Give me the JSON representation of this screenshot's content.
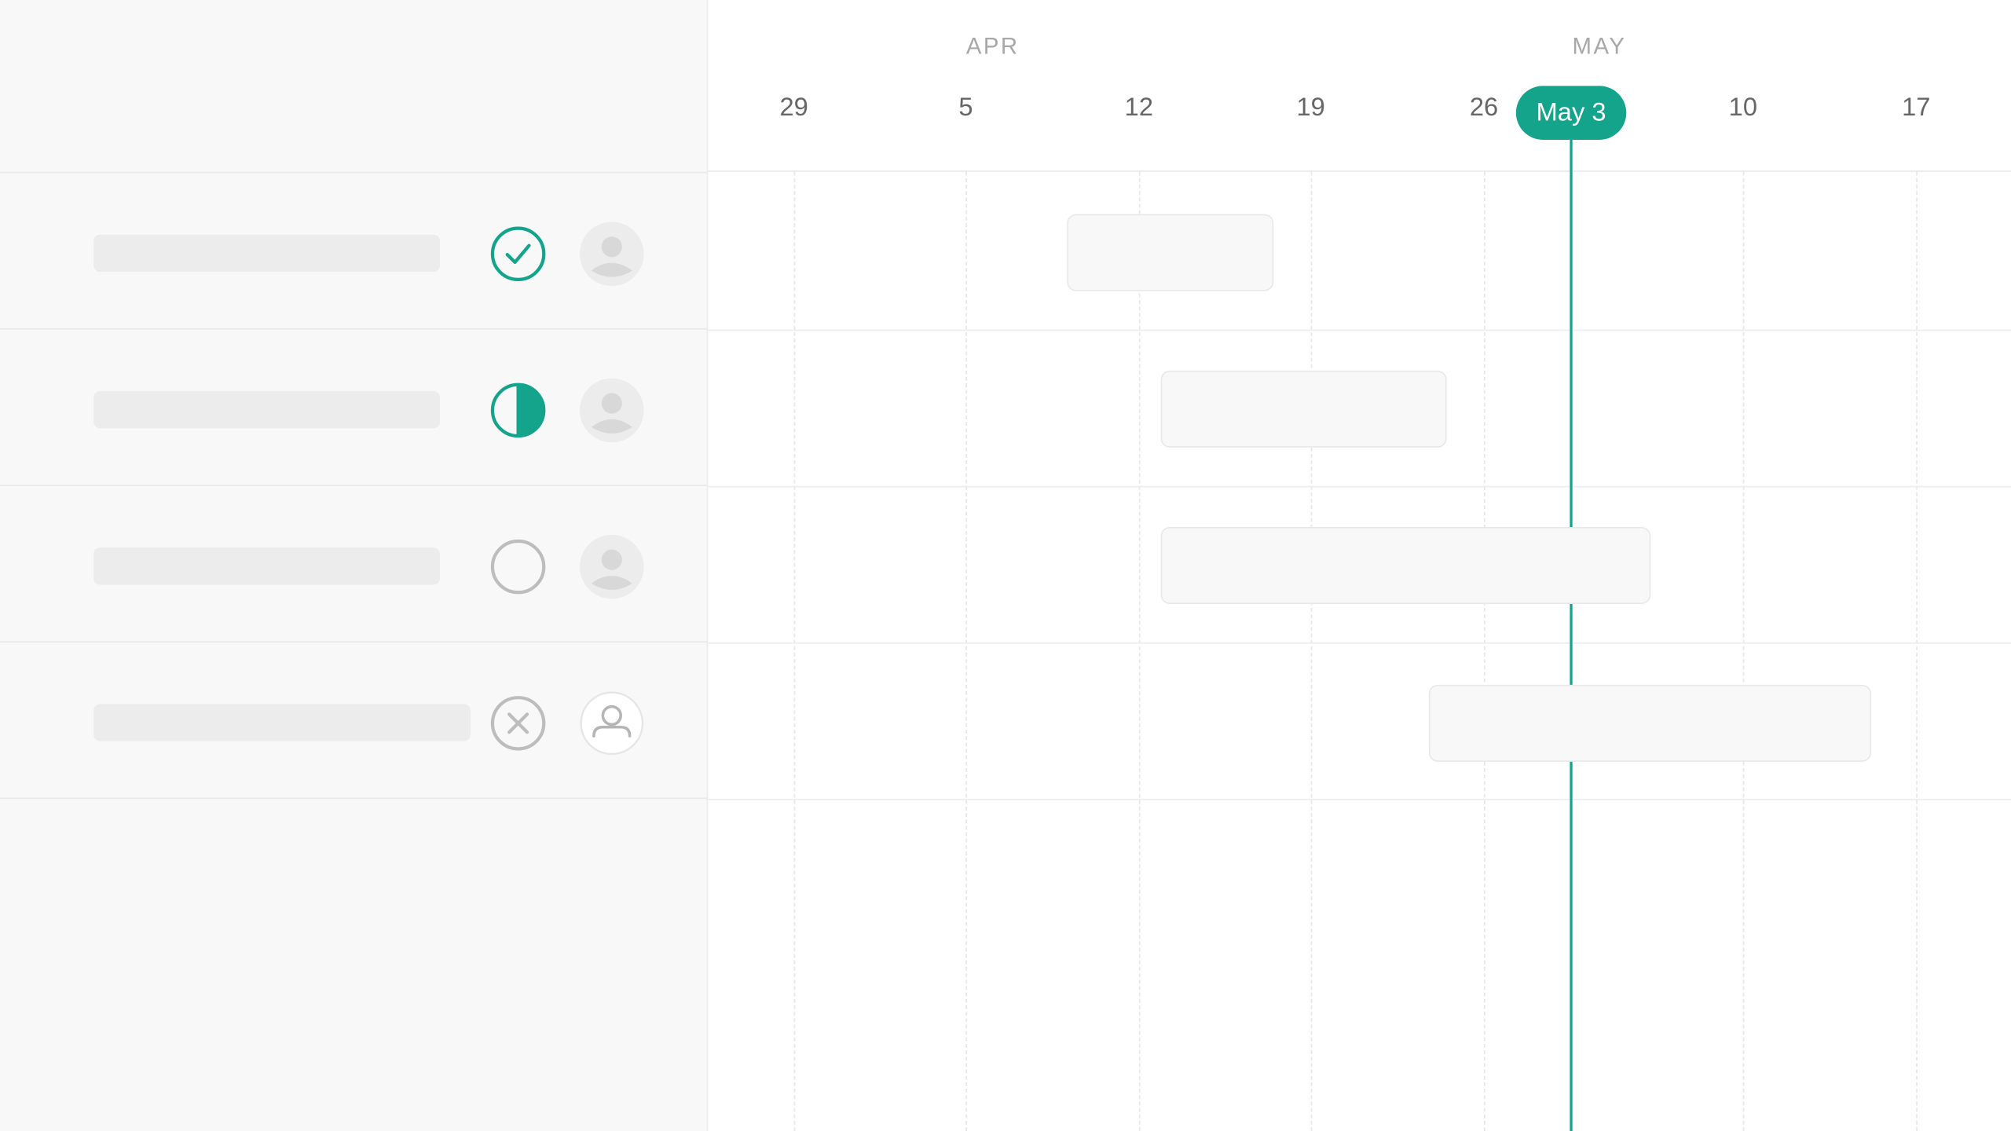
{
  "timeline": {
    "months": [
      {
        "label": "APR"
      },
      {
        "label": "MAY"
      }
    ],
    "weeks": [
      {
        "label": "29"
      },
      {
        "label": "5"
      },
      {
        "label": "12"
      },
      {
        "label": "19"
      },
      {
        "label": "26"
      },
      {
        "label": "10"
      },
      {
        "label": "17"
      }
    ],
    "today": {
      "label": "May 3"
    }
  },
  "tasks": [
    {
      "status": "complete",
      "status_icon": "check-circle-icon",
      "avatar_icon": "user-avatar-icon"
    },
    {
      "status": "in-progress",
      "status_icon": "half-circle-icon",
      "avatar_icon": "user-avatar-icon"
    },
    {
      "status": "not-started",
      "status_icon": "empty-circle-icon",
      "avatar_icon": "user-avatar-icon"
    },
    {
      "status": "cancelled",
      "status_icon": "x-circle-icon",
      "avatar_icon": "user-outline-icon"
    }
  ],
  "colors": {
    "accent": "#14a38b",
    "neutral_icon": "#bdbdbd",
    "panel_bg": "#f8f8f8"
  }
}
